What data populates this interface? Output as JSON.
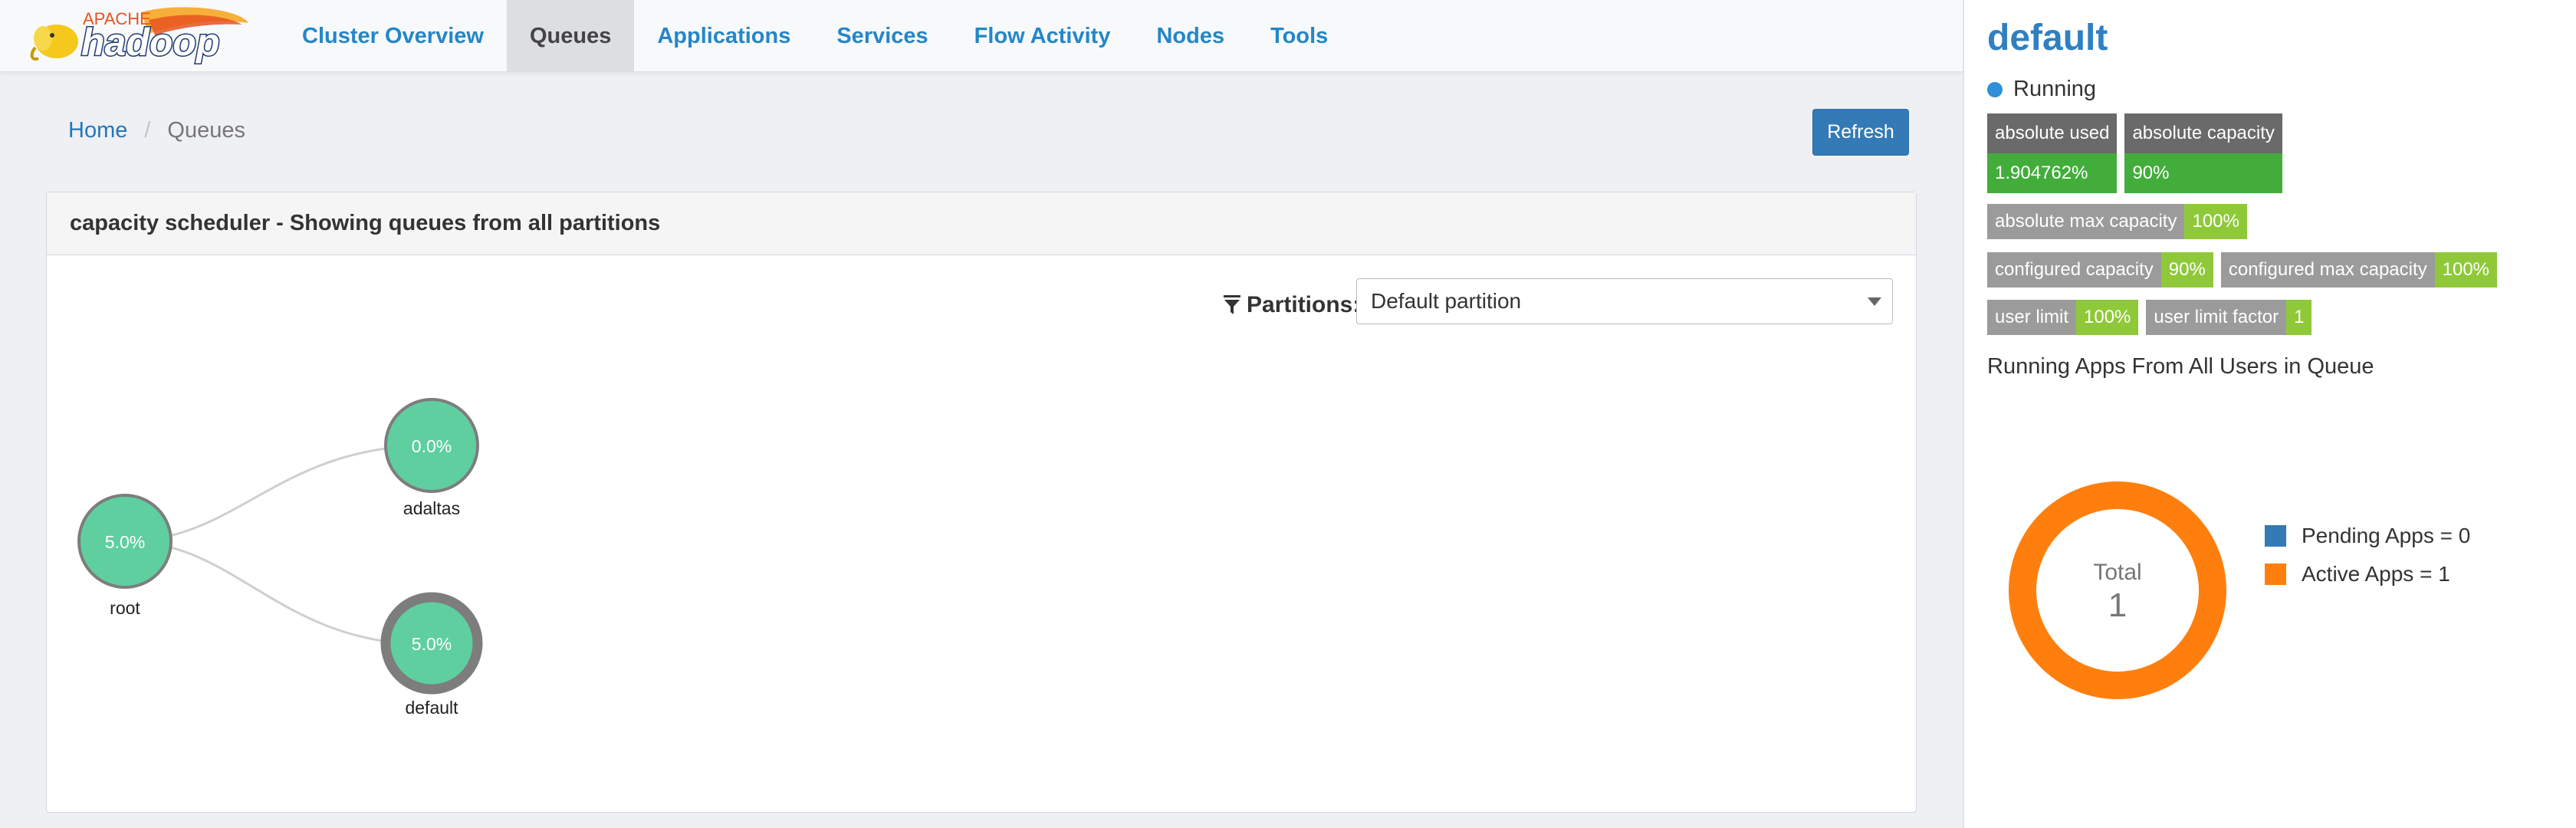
{
  "logo": {
    "apache": "APACHE",
    "hadoop": "hadoop"
  },
  "nav": {
    "tabs": [
      {
        "label": "Cluster Overview"
      },
      {
        "label": "Queues"
      },
      {
        "label": "Applications"
      },
      {
        "label": "Services"
      },
      {
        "label": "Flow Activity"
      },
      {
        "label": "Nodes"
      },
      {
        "label": "Tools"
      }
    ],
    "active": "Queues"
  },
  "breadcrumb": {
    "home": "Home",
    "separator": "/",
    "current": "Queues"
  },
  "refresh_label": "Refresh",
  "panel": {
    "heading": "capacity scheduler - Showing queues from all partitions",
    "partitions_label": "Partitions:",
    "partition_selected": "Default partition"
  },
  "queue_tree": {
    "nodes": [
      {
        "name": "root",
        "percent": "5.0%",
        "selected": false
      },
      {
        "name": "adaltas",
        "percent": "0.0%",
        "selected": false
      },
      {
        "name": "default",
        "percent": "5.0%",
        "selected": true
      }
    ]
  },
  "sidebar": {
    "queue_name": "default",
    "state": "Running",
    "absolute_used": {
      "key": "absolute used",
      "value": "1.904762%"
    },
    "absolute_capacity": {
      "key": "absolute capacity",
      "value": "90%"
    },
    "absolute_max_capacity": {
      "key": "absolute max capacity",
      "value": "100%"
    },
    "configured_capacity": {
      "key": "configured capacity",
      "value": "90%"
    },
    "configured_max_capacity": {
      "key": "configured max capacity",
      "value": "100%"
    },
    "user_limit": {
      "key": "user limit",
      "value": "100%"
    },
    "user_limit_factor": {
      "key": "user limit factor",
      "value": "1"
    },
    "apps_heading": "Running Apps From All Users in Queue",
    "donut": {
      "total_label": "Total",
      "total_value": "1"
    },
    "legend": [
      {
        "label": "Pending Apps = 0",
        "count": 0,
        "color": "#337ab7"
      },
      {
        "label": "Active Apps = 1",
        "count": 1,
        "color": "#ff7f0e"
      }
    ]
  },
  "colors": {
    "brand_link": "#2486c8",
    "node_fill": "#5fcfa0",
    "running_dot": "#2f8fd8",
    "label_green": "#8fc93a",
    "stack_green": "#43ad3c",
    "donut_active": "#ff7f0e"
  }
}
